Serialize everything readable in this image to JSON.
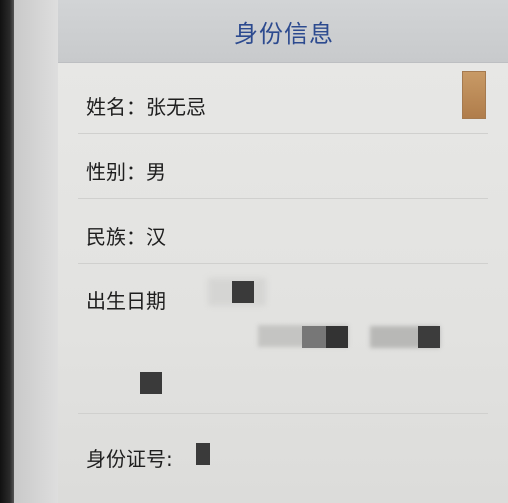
{
  "header": {
    "title": "身份信息"
  },
  "fields": {
    "name": "姓名：张无忌",
    "gender": "性别：男",
    "ethnicity": "民族：汉",
    "birth_date_label": "出生日期",
    "id_number_label": "身份证号:"
  },
  "icons": {
    "avatar": "photo-thumbnail"
  },
  "colors": {
    "title": "#2c4a8f",
    "text": "#1e1e1e",
    "header_bg": "#cbcdd0",
    "avatar": "#b98652"
  }
}
